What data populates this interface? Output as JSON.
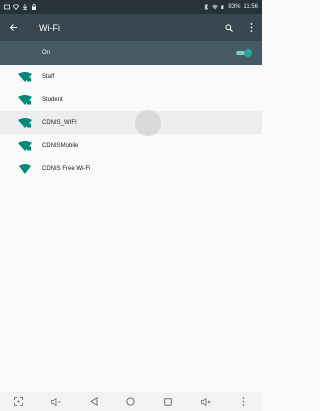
{
  "status": {
    "battery_text": "83%",
    "time": "11:56",
    "icons": [
      "notification-icon",
      "wifi-icon",
      "download-icon",
      "lock-icon",
      "bluetooth-icon",
      "signal-icon",
      "battery-icon"
    ]
  },
  "app_bar": {
    "title": "Wi-Fi",
    "back_icon": "back-arrow-icon",
    "search_icon": "search-icon",
    "more_icon": "more-vert-icon"
  },
  "switch": {
    "label": "On",
    "state": "on",
    "accent": "#26a69a"
  },
  "networks": [
    {
      "name": "Staff",
      "icon": "wifi-locked-icon",
      "selected": false
    },
    {
      "name": "Student",
      "icon": "wifi-locked-icon",
      "selected": false
    },
    {
      "name": "CDNIS_WIFI",
      "icon": "wifi-locked-icon",
      "selected": true
    },
    {
      "name": "CDNISMobile",
      "icon": "wifi-locked-icon",
      "selected": false
    },
    {
      "name": "CDNIS Free Wi-Fi",
      "icon": "wifi-open-icon",
      "selected": false
    }
  ],
  "nav": [
    "screenshot-icon",
    "volume-down-icon",
    "back-icon",
    "home-icon",
    "recents-icon",
    "volume-up-icon",
    "menu-icon"
  ],
  "colors": {
    "status_bar": "#263238",
    "app_bar": "#37474f",
    "switch_bar": "#455a64",
    "wifi_icon": "#00897b"
  }
}
